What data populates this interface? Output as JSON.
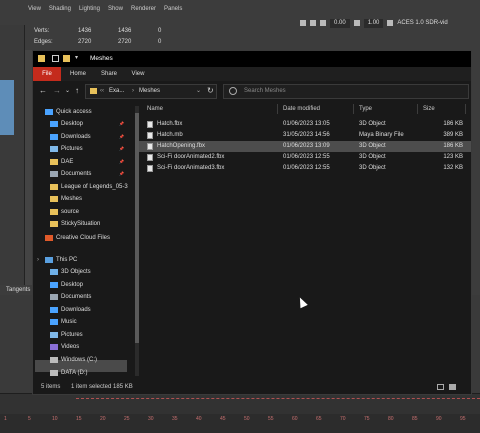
{
  "maya": {
    "menu": [
      "View",
      "Shading",
      "Lighting",
      "Show",
      "Renderer",
      "Panels"
    ],
    "hud": [
      {
        "label": "Verts:",
        "a": "1436",
        "b": "1436",
        "c": "0"
      },
      {
        "label": "Edges:",
        "a": "2720",
        "b": "2720",
        "c": "0"
      }
    ],
    "toolbar": {
      "value1": "0.00",
      "value2": "1.00",
      "colorspace": "ACES 1.0 SDR-vid"
    },
    "tangents_label": "Tangents",
    "timeline_ticks": [
      "1",
      "5",
      "10",
      "15",
      "20",
      "25",
      "30",
      "35",
      "40",
      "45",
      "50",
      "55",
      "60",
      "65",
      "70",
      "75",
      "80",
      "85",
      "90",
      "95"
    ]
  },
  "explorer": {
    "title": "Meshes",
    "tabs": [
      "File",
      "Home",
      "Share",
      "View"
    ],
    "address": {
      "parent": "Exa...",
      "current": "Meshes"
    },
    "search_placeholder": "Search Meshes",
    "nav": [
      {
        "label": "Quick access",
        "icon": "star-icon",
        "pinned": false,
        "indent": 0
      },
      {
        "label": "Desktop",
        "icon": "desktop-folder-icon",
        "pinned": true,
        "indent": 1
      },
      {
        "label": "Downloads",
        "icon": "downloads-icon",
        "pinned": true,
        "indent": 1
      },
      {
        "label": "Pictures",
        "icon": "pictures-folder-icon",
        "pinned": true,
        "indent": 1
      },
      {
        "label": "DAE",
        "icon": "folder-icon",
        "pinned": true,
        "indent": 1
      },
      {
        "label": "Documents",
        "icon": "documents-folder-icon",
        "pinned": true,
        "indent": 1
      },
      {
        "label": "League of Legends_05-3",
        "icon": "folder-icon",
        "pinned": false,
        "indent": 1
      },
      {
        "label": "Meshes",
        "icon": "folder-icon",
        "pinned": false,
        "indent": 1
      },
      {
        "label": "source",
        "icon": "folder-icon",
        "pinned": false,
        "indent": 1
      },
      {
        "label": "StickySituation",
        "icon": "folder-icon",
        "pinned": false,
        "indent": 1
      },
      {
        "label": "Creative Cloud Files",
        "icon": "creative-cloud-icon",
        "pinned": false,
        "indent": 0
      },
      {
        "label": "This PC",
        "icon": "this-pc-icon",
        "pinned": false,
        "indent": 0
      },
      {
        "label": "3D Objects",
        "icon": "3d-objects-icon",
        "pinned": false,
        "indent": 1
      },
      {
        "label": "Desktop",
        "icon": "desktop-folder-icon",
        "pinned": false,
        "indent": 1
      },
      {
        "label": "Documents",
        "icon": "documents-folder-icon",
        "pinned": false,
        "indent": 1
      },
      {
        "label": "Downloads",
        "icon": "downloads-icon",
        "pinned": false,
        "indent": 1
      },
      {
        "label": "Music",
        "icon": "music-icon",
        "pinned": false,
        "indent": 1
      },
      {
        "label": "Pictures",
        "icon": "pictures-folder-icon",
        "pinned": false,
        "indent": 1
      },
      {
        "label": "Videos",
        "icon": "videos-icon",
        "pinned": false,
        "indent": 1
      },
      {
        "label": "Windows (C:)",
        "icon": "drive-icon",
        "pinned": false,
        "indent": 1
      },
      {
        "label": "DATA (D:)",
        "icon": "drive-icon",
        "pinned": false,
        "indent": 1
      }
    ],
    "columns": [
      "Name",
      "Date modified",
      "Type",
      "Size"
    ],
    "files": [
      {
        "name": "Hatch.fbx",
        "date": "01/06/2023 13:05",
        "type": "3D Object",
        "size": "186 KB"
      },
      {
        "name": "Hatch.mb",
        "date": "31/05/2023 14:56",
        "type": "Maya Binary File",
        "size": "389 KB"
      },
      {
        "name": "HatchOpening.fbx",
        "date": "01/06/2023 13:09",
        "type": "3D Object",
        "size": "186 KB"
      },
      {
        "name": "Sci-Fi doorAnimated2.fbx",
        "date": "01/06/2023 12:55",
        "type": "3D Object",
        "size": "123 KB"
      },
      {
        "name": "Sci-Fi doorAnimated3.fbx",
        "date": "01/06/2023 12:55",
        "type": "3D Object",
        "size": "132 KB"
      }
    ],
    "selected_index": 2,
    "status": {
      "count": "5 items",
      "selection": "1 item selected  185 KB"
    }
  }
}
